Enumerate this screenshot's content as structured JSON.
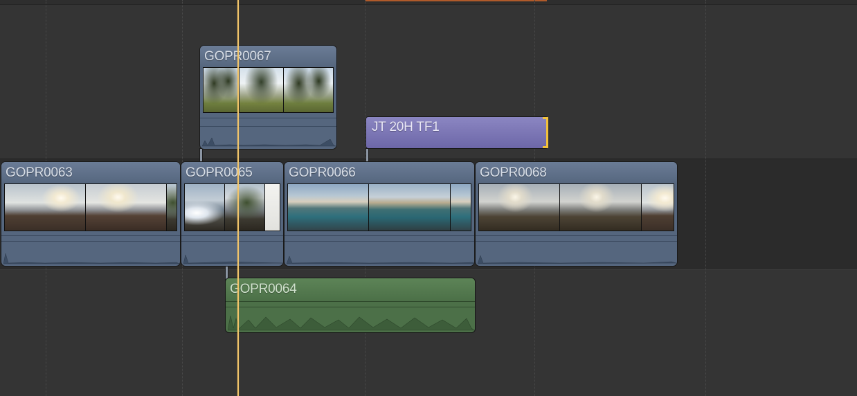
{
  "timeline": {
    "range_color": "#b05a2a",
    "playhead_color": "#f3c66c",
    "primary_storyline": [
      {
        "name": "GOPR0063",
        "frames": [
          "f-sunset",
          "f-sunset2"
        ]
      },
      {
        "name": "GOPR0065",
        "frames": [
          "f-sparkle",
          "f-rocks",
          "f-white"
        ]
      },
      {
        "name": "GOPR0066",
        "frames": [
          "f-water",
          "f-water2",
          "f-water"
        ]
      },
      {
        "name": "GOPR0068",
        "frames": [
          "f-dusk",
          "f-dusk",
          "f-dusk"
        ]
      }
    ],
    "connected_clips": {
      "above": {
        "name": "GOPR0067",
        "frames": [
          "f-palms",
          "f-palms2",
          "f-palms"
        ]
      },
      "below": {
        "name": "GOPR0064"
      }
    },
    "title_clip": {
      "name": "JT 20H TF1",
      "color": "#7d78b8"
    },
    "secondary_color": "#4c7048",
    "clip_color": "#5b6c86"
  }
}
